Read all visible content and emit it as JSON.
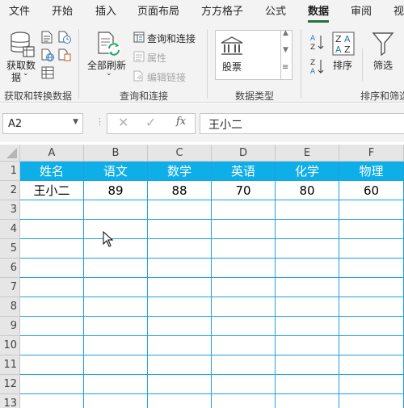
{
  "tabs": [
    "文件",
    "开始",
    "插入",
    "页面布局",
    "方方格子",
    "公式",
    "数据",
    "审阅",
    "视"
  ],
  "active_tab": "数据",
  "ribbon": {
    "get_data_line1": "获取数",
    "get_data_line2": "据",
    "get_transform_label": "获取和转换数据",
    "refresh_all": "全部刷新",
    "query_connections": "查询和连接",
    "properties": "属性",
    "edit_links": "编辑链接",
    "queries_group_label": "查询和连接",
    "stocks": "股票",
    "data_types_label": "数据类型",
    "sort": "排序",
    "filter": "筛选",
    "sort_filter_label": "排序和筛选"
  },
  "formula_bar": {
    "name_box": "A2",
    "fx": "fx",
    "content": "王小二"
  },
  "sheet": {
    "columns": [
      "A",
      "B",
      "C",
      "D",
      "E",
      "F"
    ],
    "rows": [
      "1",
      "2",
      "3",
      "4",
      "5",
      "6",
      "7",
      "8",
      "9",
      "10",
      "11",
      "12",
      "13"
    ],
    "header_row": [
      "姓名",
      "语文",
      "数学",
      "英语",
      "化学",
      "物理"
    ],
    "data_row": [
      "王小二",
      "89",
      "88",
      "70",
      "80",
      "60"
    ]
  },
  "colors": {
    "accent": "#217346",
    "header_fill": "#0EAEE9",
    "grid_line": "#1AA3DC"
  }
}
